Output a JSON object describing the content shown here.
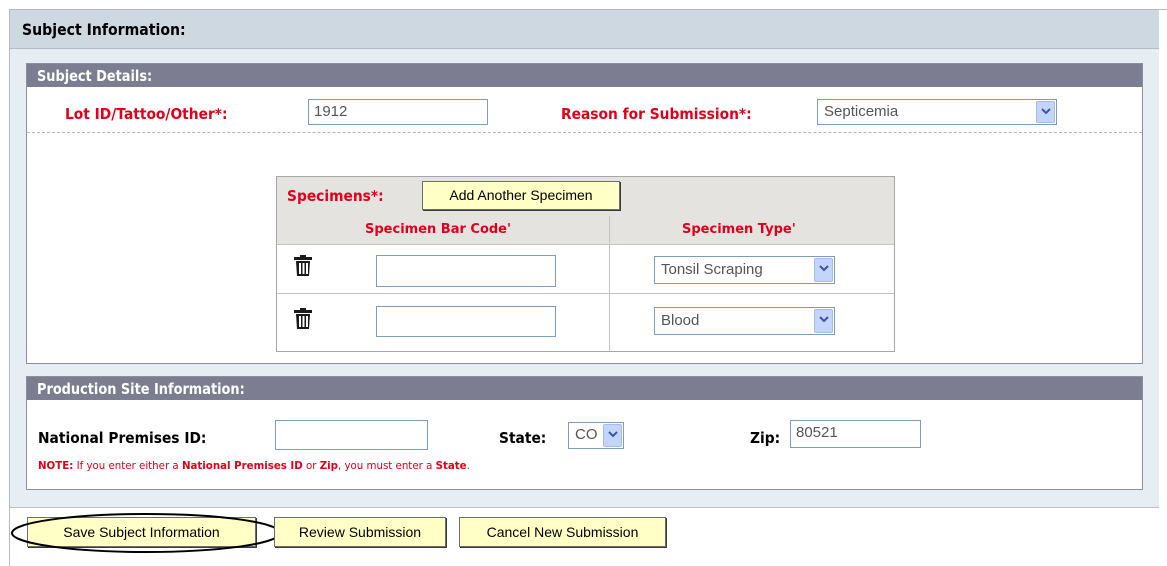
{
  "subject_info": {
    "title": "Subject Information:"
  },
  "subject_details": {
    "title": "Subject Details:",
    "lot_id_label": "Lot ID/Tattoo/Other*:",
    "lot_id_value": "1912",
    "reason_label": "Reason for Submission*:",
    "reason_value": "Septicemia"
  },
  "specimens": {
    "label": "Specimens*:",
    "add_button": "Add Another Specimen",
    "col_barcode": "Specimen Bar Code'",
    "col_type": "Specimen Type'",
    "rows": [
      {
        "barcode": "",
        "type": "Tonsil Scraping"
      },
      {
        "barcode": "",
        "type": "Blood"
      }
    ]
  },
  "production_site": {
    "title": "Production Site Information:",
    "npid_label": "National Premises ID:",
    "npid_value": "",
    "state_label": "State:",
    "state_value": "CO",
    "zip_label": "Zip:",
    "zip_value": "80521",
    "note_prefix": "NOTE:",
    "note_1": " If you enter either a ",
    "note_npid": "National Premises ID",
    "note_2": " or ",
    "note_zip": "Zip",
    "note_3": ", you must enter a ",
    "note_state": "State",
    "note_4": "."
  },
  "actions": {
    "save": "Save Subject Information",
    "review": "Review Submission",
    "cancel": "Cancel New Submission"
  },
  "colors": {
    "required_label": "#e0001b",
    "panel_header": "#7c7d90",
    "outer_header": "#cdd8e0",
    "button_bg": "#ffffc6"
  },
  "icons": {
    "delete": "trash-icon",
    "dropdown": "chevron-down-icon"
  }
}
